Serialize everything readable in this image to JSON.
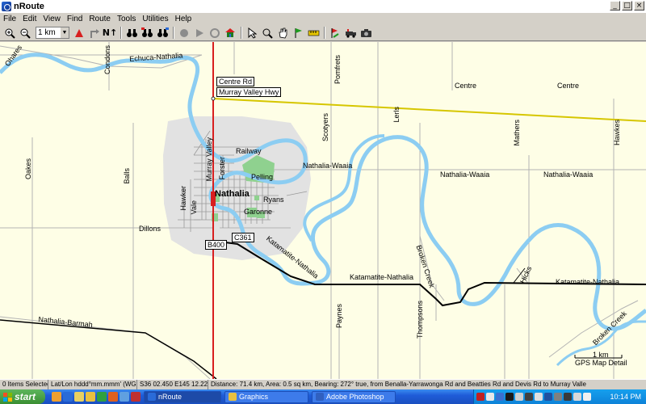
{
  "window": {
    "title": "nRoute"
  },
  "menu": [
    "File",
    "Edit",
    "View",
    "Find",
    "Route",
    "Tools",
    "Utilities",
    "Help"
  ],
  "toolbar": {
    "scale_value": "1 km",
    "buttons": [
      "zoom-in-icon",
      "zoom-out-icon",
      "map-scale-select",
      "triangle-marker-icon",
      "turn-arrow-icon",
      "north-up-icon",
      "binoculars-icon",
      "binoculars-back-icon",
      "binoculars-add-icon",
      "record-icon",
      "play-icon",
      "stop-icon",
      "home-icon",
      "select-arrow-icon",
      "zoom-tool-icon",
      "hand-tool-icon",
      "flag-tool-icon",
      "measure-tool-icon",
      "route-tool-icon",
      "vehicle-icon",
      "camera-icon"
    ]
  },
  "map": {
    "roads": {
      "echuca_nathalia": "Echuca-Nathalia",
      "ohares": "Ohares",
      "condons": "Condons",
      "centre_rd": "Centre Rd",
      "murray_valley_hwy": "Murray Valley Hwy",
      "centre_1": "Centre",
      "centre_2": "Centre",
      "pomfrets": "Pomfrets",
      "lerls": "Lerls",
      "scotyers": "Scotyers",
      "mathers": "Mathers",
      "hawkes": "Hawkes",
      "oakes": "Oakes",
      "balls": "Balls",
      "dillons": "Dillons",
      "railway": "Railway",
      "murray_valley": "Murray Valley",
      "forster": "Forster",
      "pelling": "Pelling",
      "hawker": "Hawker",
      "vale": "Vale",
      "ryans": "Ryans",
      "garonne": "Garonne",
      "nathalia_waaia_1": "Nathalia-Waaia",
      "nathalia_waaia_2": "Nathalia-Waaia",
      "nathalia_waaia_3": "Nathalia-Waaia",
      "katamatite_nathalia_1": "Katamatite-Nathalia",
      "katamatite_nathalia_2": "Katamatite-Nathalia",
      "katamatite_nathalia_diag": "Katamatite-Nathalia",
      "broken_creek_1": "Broken Creek",
      "broken_creek_2": "Broken Creek",
      "hicks": "Hicks",
      "paynes": "Paynes",
      "thompsons": "Thompsons",
      "nathalia_barmah": "Nathalia-Barmah"
    },
    "town": "Nathalia",
    "shields": {
      "b400": "B400",
      "c361": "C361"
    },
    "scale_label": "1 km",
    "map_detail": "GPS Map Detail",
    "colors": {
      "background": "#fefee6",
      "river": "#8ccdf2",
      "town_area": "#e2e2e2",
      "park": "#8fd18f",
      "highway_red": "#d81f1f",
      "highway_yellow": "#d6c600",
      "road_black": "#000000",
      "minor_road": "#b4b4b4"
    }
  },
  "status": {
    "selected": "0 Items Selected",
    "format": "Lat/Lon hddd°mm.mmm' (WGS 84)",
    "coords": "S36 02.450 E145 12.226",
    "info": "Distance: 71.4 km, Area: 0.5 sq km, Bearing: 272° true, from Benalla-Yarrawonga Rd and Beatties Rd and Devis Rd to Murray Valle"
  },
  "taskbar": {
    "start": "start",
    "tasks": [
      "nRoute",
      "Graphics",
      "Adobe Photoshop"
    ],
    "clock": "10:14 PM"
  }
}
